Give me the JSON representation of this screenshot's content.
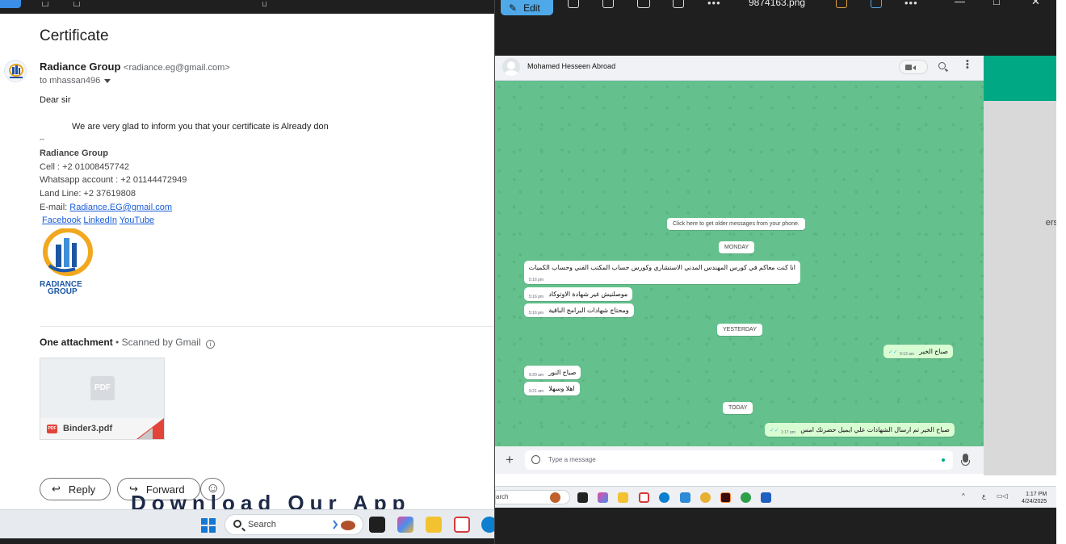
{
  "gmail": {
    "subject": "Certificate",
    "sender_name": "Radiance Group",
    "sender_email": "<radiance.eg@gmail.com>",
    "to_line": "to mhassan496",
    "greeting": "Dear sir",
    "body": "We are very glad to inform you that your certificate is Already don",
    "sig_sep": "--",
    "sig_name": "Radiance Group",
    "cell": "Cell : +2 01008457742",
    "whatsapp": "Whatsapp account : +2 01144472949",
    "landline": "Land Line: +2 37619808",
    "email_label": "E-mail: ",
    "email_link": "Radiance.EG@gmail.com",
    "links": [
      "Facebook",
      "LinkedIn",
      "YouTube"
    ],
    "logo_text_1": "RADIANCE",
    "logo_text_2": "GROUP",
    "attachment_title": "One attachment",
    "scanned": "• Scanned by Gmail",
    "attachment_name": "Binder3.pdf",
    "pdf_glyph": "PDF",
    "pdf_badge": "PDF",
    "reply": "Reply",
    "forward": "Forward",
    "banner": "Download Our App"
  },
  "left_taskbar": {
    "search_text": "Search"
  },
  "viewer": {
    "edit_label": "Edit",
    "filename": "9874163.png"
  },
  "whatsapp": {
    "contact": "Mohamed Hesseen Abroad",
    "older_messages": "Click here to get older messages from your phone.",
    "day_monday": "MONDAY",
    "day_yesterday": "YESTERDAY",
    "day_today": "TODAY",
    "messages": [
      {
        "text": "انا كنت معاكم في كورس المهندس المدني الاستشاري وكورس حساب المكتب الفني وحساب الكميات",
        "time": "5:16 pm"
      },
      {
        "text": "موصلنيش غير شهادة الاوتوكاد",
        "time": "5:16 pm"
      },
      {
        "text": "ومحتاج شهادات البرامج الباقية",
        "time": "5:16 pm"
      },
      {
        "text": "صباح الخير",
        "time": "9:13 am"
      },
      {
        "text": "صباح النور",
        "time": "9:20 am"
      },
      {
        "text": "اهلا وسهلا",
        "time": "9:21 am"
      },
      {
        "text": "صباح الخير تم ارسال الشهادات علي ايميل حضرتك امس",
        "time": "1:17 pm"
      }
    ],
    "input_placeholder": "Type a message",
    "right_edge_text": "ers"
  },
  "shot_taskbar": {
    "search_fragment": "arch",
    "tray_lang": "ع",
    "clock_time": "1:17 PM",
    "clock_date": "4/24/2025"
  },
  "colors": {
    "wa_green": "#64c08c",
    "wa_accent": "#00a884",
    "link_blue": "#1a5dd8",
    "pdf_red": "#e2443a",
    "viewer_edit": "#4fa8e8"
  }
}
